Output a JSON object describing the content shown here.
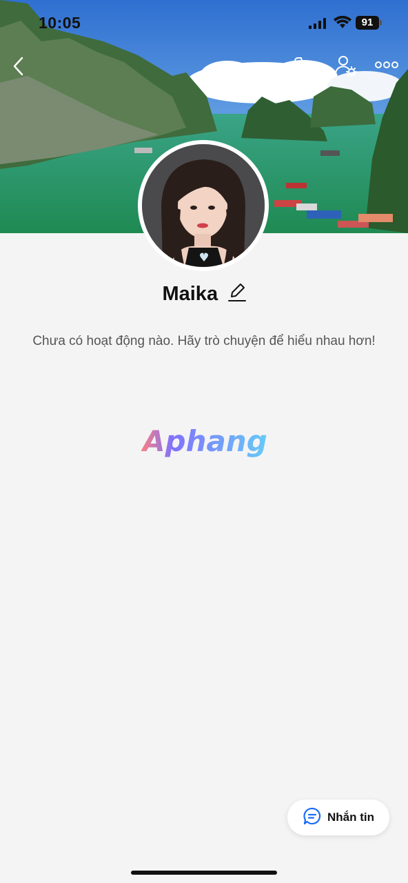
{
  "status_bar": {
    "time": "10:05",
    "battery": "91"
  },
  "nav": {
    "back_icon": "chevron-left-icon",
    "call_icon": "phone-icon",
    "settings_icon": "user-gear-icon",
    "more_icon": "more-dots-icon"
  },
  "profile": {
    "name": "Maika",
    "edit_icon": "pencil-icon",
    "empty_message": "Chưa có hoạt động nào. Hãy trò chuyện để hiểu nhau hơn!"
  },
  "watermark": {
    "text": "Aphang"
  },
  "actions": {
    "message_label": "Nhắn tin",
    "message_icon": "chat-bubble-icon"
  },
  "colors": {
    "accent": "#1a6cf5",
    "page_bg": "#f4f4f4",
    "water": "#2e9a66"
  }
}
